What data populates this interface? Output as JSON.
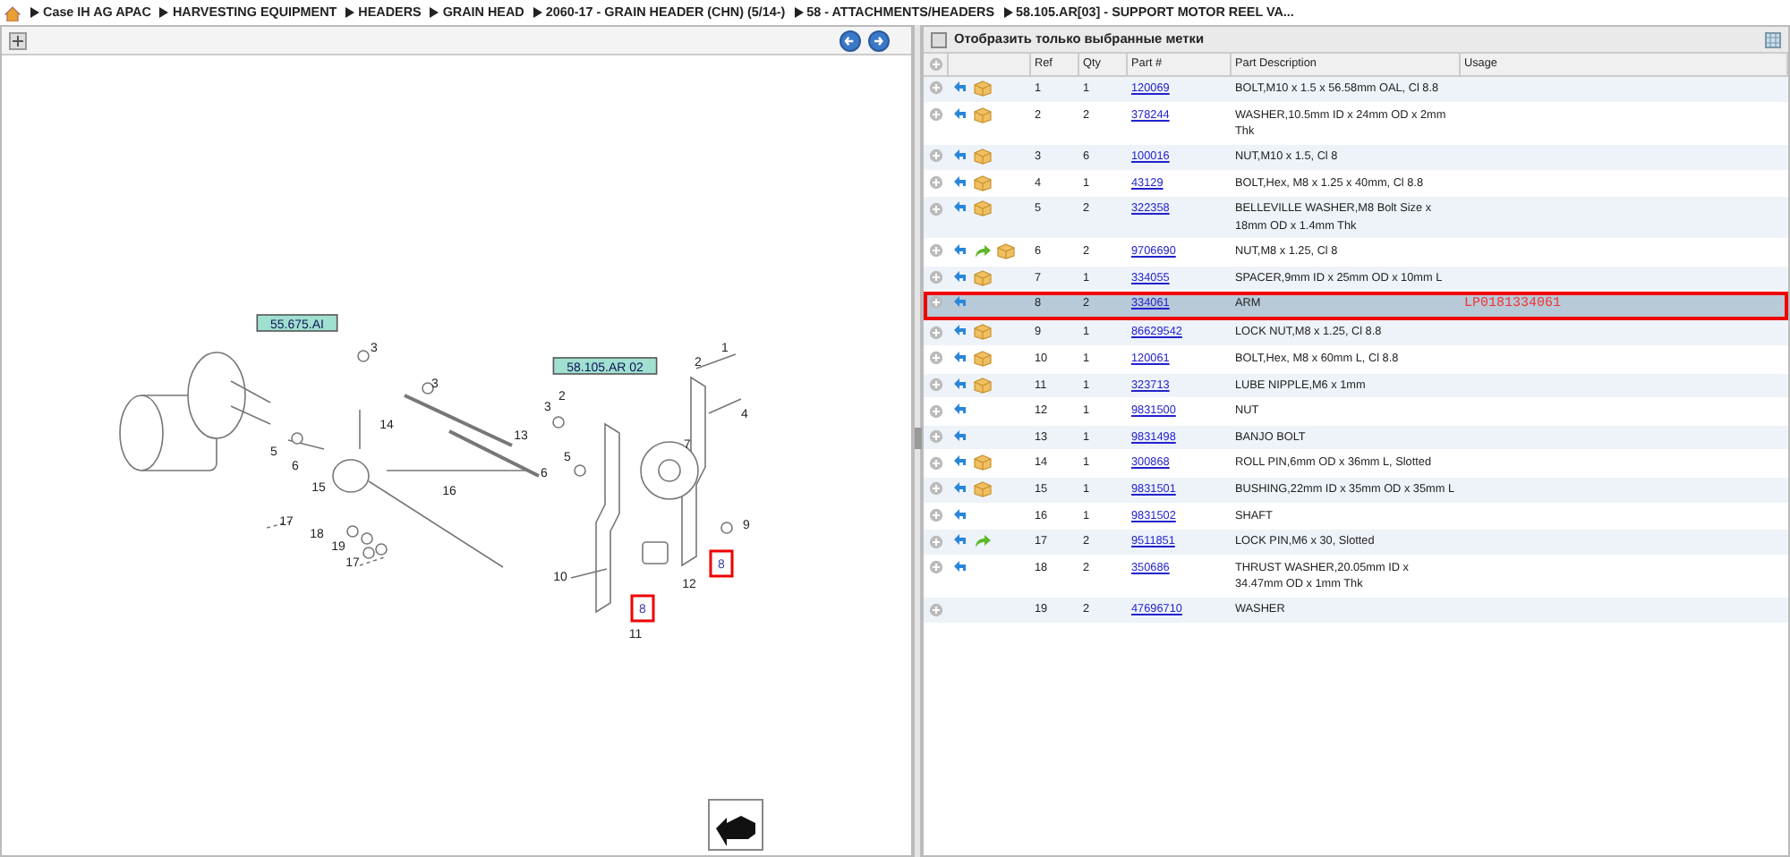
{
  "breadcrumb": [
    "Case IH AG APAC",
    "HARVESTING EQUIPMENT",
    "HEADERS",
    "GRAIN HEAD",
    "2060-17 - GRAIN HEADER (CHN) (5/14-)",
    "58 - ATTACHMENTS/HEADERS",
    "58.105.AR[03] - SUPPORT MOTOR REEL VA..."
  ],
  "diagram": {
    "callouts": [
      {
        "text": "55.675.AI",
        "kind": "reference",
        "highlighted": false
      },
      {
        "text": "58.105.AR 02",
        "kind": "reference",
        "highlighted": false
      },
      {
        "text": "3",
        "kind": "number",
        "highlighted": false
      },
      {
        "text": "3",
        "kind": "number",
        "highlighted": false
      },
      {
        "text": "14",
        "kind": "number",
        "highlighted": false
      },
      {
        "text": "13",
        "kind": "number",
        "highlighted": false
      },
      {
        "text": "5",
        "kind": "number",
        "highlighted": false
      },
      {
        "text": "6",
        "kind": "number",
        "highlighted": false
      },
      {
        "text": "15",
        "kind": "number",
        "highlighted": false
      },
      {
        "text": "16",
        "kind": "number",
        "highlighted": false
      },
      {
        "text": "17",
        "kind": "number",
        "highlighted": false
      },
      {
        "text": "18",
        "kind": "number",
        "highlighted": false
      },
      {
        "text": "19",
        "kind": "number",
        "highlighted": false
      },
      {
        "text": "17",
        "kind": "number",
        "highlighted": false
      },
      {
        "text": "1",
        "kind": "number",
        "highlighted": false
      },
      {
        "text": "2",
        "kind": "number",
        "highlighted": false
      },
      {
        "text": "4",
        "kind": "number",
        "highlighted": false
      },
      {
        "text": "2",
        "kind": "number",
        "highlighted": false
      },
      {
        "text": "3",
        "kind": "number",
        "highlighted": false
      },
      {
        "text": "7",
        "kind": "number",
        "highlighted": false
      },
      {
        "text": "5",
        "kind": "number",
        "highlighted": false
      },
      {
        "text": "6",
        "kind": "number",
        "highlighted": false
      },
      {
        "text": "9",
        "kind": "number",
        "highlighted": false
      },
      {
        "text": "8",
        "kind": "number",
        "highlighted": true
      },
      {
        "text": "10",
        "kind": "number",
        "highlighted": false
      },
      {
        "text": "12",
        "kind": "number",
        "highlighted": false
      },
      {
        "text": "8",
        "kind": "number",
        "highlighted": true
      },
      {
        "text": "11",
        "kind": "number",
        "highlighted": false
      }
    ]
  },
  "filter": {
    "label": "Отобразить только выбранные метки",
    "checked": false
  },
  "table": {
    "columns": [
      "Ref",
      "Qty",
      "Part #",
      "Part Description",
      "Usage"
    ],
    "rows": [
      {
        "ref": "1",
        "qty": "1",
        "part": "120069",
        "description": "BOLT,M10 x 1.5 x 56.58mm OAL, Cl 8.8",
        "link": true,
        "stock": true,
        "alternate": false,
        "selected": false
      },
      {
        "ref": "2",
        "qty": "2",
        "part": "378244",
        "description": "WASHER,10.5mm ID x 24mm OD x 2mm Thk",
        "link": true,
        "stock": true,
        "alternate": false,
        "selected": false
      },
      {
        "ref": "3",
        "qty": "6",
        "part": "100016",
        "description": "NUT,M10 x 1.5, Cl 8",
        "link": true,
        "stock": true,
        "alternate": false,
        "selected": false
      },
      {
        "ref": "4",
        "qty": "1",
        "part": "43129",
        "description": "BOLT,Hex, M8 x 1.25 x 40mm, Cl 8.8",
        "link": true,
        "stock": true,
        "alternate": false,
        "selected": false
      },
      {
        "ref": "5",
        "qty": "2",
        "part": "322358",
        "description": "BELLEVILLE WASHER,M8 Bolt Size x 18mm OD x 1.4mm Thk",
        "link": true,
        "stock": true,
        "alternate": false,
        "selected": false
      },
      {
        "ref": "6",
        "qty": "2",
        "part": "9706690",
        "description": "NUT,M8 x 1.25, Cl 8",
        "link": true,
        "stock": true,
        "alternate": true,
        "selected": false
      },
      {
        "ref": "7",
        "qty": "1",
        "part": "334055",
        "description": "SPACER,9mm ID x 25mm OD x 10mm L",
        "link": true,
        "stock": true,
        "alternate": false,
        "selected": false
      },
      {
        "ref": "8",
        "qty": "2",
        "part": "334061",
        "description": "ARM",
        "usage": "LP0181334061",
        "link": true,
        "stock": false,
        "alternate": false,
        "selected": true
      },
      {
        "ref": "9",
        "qty": "1",
        "part": "86629542",
        "description": "LOCK NUT,M8 x 1.25, Cl 8.8",
        "link": true,
        "stock": true,
        "alternate": false,
        "selected": false
      },
      {
        "ref": "10",
        "qty": "1",
        "part": "120061",
        "description": "BOLT,Hex, M8 x 60mm L, Cl 8.8",
        "link": true,
        "stock": true,
        "alternate": false,
        "selected": false
      },
      {
        "ref": "11",
        "qty": "1",
        "part": "323713",
        "description": "LUBE NIPPLE,M6 x 1mm",
        "link": true,
        "stock": true,
        "alternate": false,
        "selected": false
      },
      {
        "ref": "12",
        "qty": "1",
        "part": "9831500",
        "description": "NUT",
        "link": true,
        "stock": false,
        "alternate": false,
        "selected": false
      },
      {
        "ref": "13",
        "qty": "1",
        "part": "9831498",
        "description": "BANJO BOLT",
        "link": true,
        "stock": false,
        "alternate": false,
        "selected": false
      },
      {
        "ref": "14",
        "qty": "1",
        "part": "300868",
        "description": "ROLL PIN,6mm OD x 36mm L, Slotted",
        "link": true,
        "stock": true,
        "alternate": false,
        "selected": false
      },
      {
        "ref": "15",
        "qty": "1",
        "part": "9831501",
        "description": "BUSHING,22mm ID x 35mm OD x 35mm L",
        "link": true,
        "stock": true,
        "alternate": false,
        "selected": false
      },
      {
        "ref": "16",
        "qty": "1",
        "part": "9831502",
        "description": "SHAFT",
        "link": true,
        "stock": false,
        "alternate": false,
        "selected": false
      },
      {
        "ref": "17",
        "qty": "2",
        "part": "9511851",
        "description": "LOCK PIN,M6 x 30, Slotted",
        "link": true,
        "stock": false,
        "alternate": true,
        "selected": false
      },
      {
        "ref": "18",
        "qty": "2",
        "part": "350686",
        "description": "THRUST WASHER,20.05mm ID x 34.47mm OD x 1mm Thk",
        "link": true,
        "stock": false,
        "alternate": false,
        "selected": false
      },
      {
        "ref": "19",
        "qty": "2",
        "part": "47696710",
        "description": "WASHER",
        "link": false,
        "stock": false,
        "alternate": false,
        "selected": false
      }
    ]
  }
}
